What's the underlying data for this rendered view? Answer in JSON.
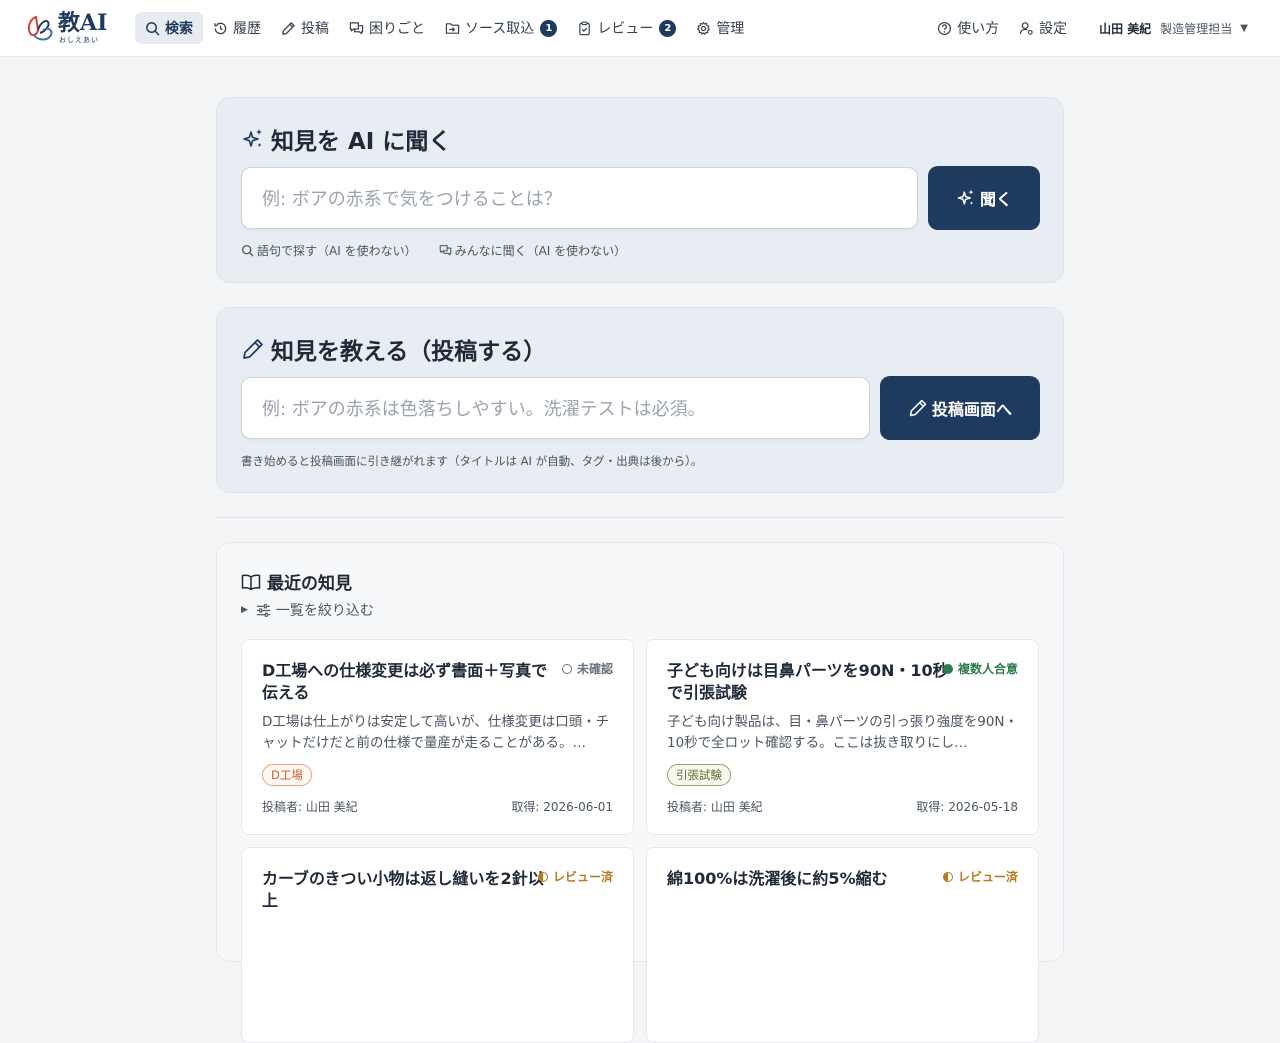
{
  "app": {
    "logo_main": "教AI",
    "logo_sub": "おしえあい"
  },
  "nav": {
    "items": [
      {
        "label": "検索",
        "icon": "search-icon",
        "active": true
      },
      {
        "label": "履歴",
        "icon": "history-icon"
      },
      {
        "label": "投稿",
        "icon": "pencil-icon"
      },
      {
        "label": "困りごと",
        "icon": "chat-icon"
      },
      {
        "label": "ソース取込",
        "icon": "import-icon",
        "badge": "1"
      },
      {
        "label": "レビュー",
        "icon": "clipboard-check-icon",
        "badge": "2"
      },
      {
        "label": "管理",
        "icon": "gear-icon"
      }
    ],
    "help": "使い方",
    "settings": "設定",
    "user_name": "山田 美紀",
    "user_role": "製造管理担当",
    "user_caret": "▼"
  },
  "ask": {
    "title": "知見を AI に聞く",
    "placeholder": "例: ボアの赤系で気をつけることは？",
    "button": "聞く",
    "sub_search": "語句で探す（AI を使わない）",
    "sub_ask_all": "みんなに聞く（AI を使わない）"
  },
  "teach": {
    "title": "知見を教える（投稿する）",
    "placeholder": "例: ボアの赤系は色落ちしやすい。洗濯テストは必須。",
    "button": "投稿画面へ",
    "hint": "書き始めると投稿画面に引き継がれます（タイトルは AI が自動、タグ・出典は後から）。"
  },
  "recent": {
    "title": "最近の知見",
    "filter_label": "一覧を絞り込む",
    "cards": [
      {
        "title": "D工場への仕様変更は必ず書面＋写真で伝える",
        "status": "未確認",
        "body": "D工場は仕上がりは安定して高いが、仕様変更は口頭・チャットだけだと前の仕様で量産が走ることがある。…",
        "tag": "D工場",
        "author": "投稿者: 山田 美紀",
        "date": "取得: 2026-06-01"
      },
      {
        "title": "子ども向けは目鼻パーツを90N・10秒で引張試験",
        "status": "複数人合意",
        "body": "子ども向け製品は、目・鼻パーツの引っ張り強度を90N・10秒で全ロット確認する。ここは抜き取りにし…",
        "tag": "引張試験",
        "author": "投稿者: 山田 美紀",
        "date": "取得: 2026-05-18"
      },
      {
        "title": "カーブのきつい小物は返し縫いを2針以上",
        "status": "レビュー済"
      },
      {
        "title": "綿100%は洗濯後に約5%縮む",
        "status": "レビュー済"
      }
    ]
  },
  "colors": {
    "primary": "#1e3a5f",
    "agreed": "#2f7d4a",
    "reviewed": "#b7791f",
    "unconfirmed": "#6b7280"
  }
}
